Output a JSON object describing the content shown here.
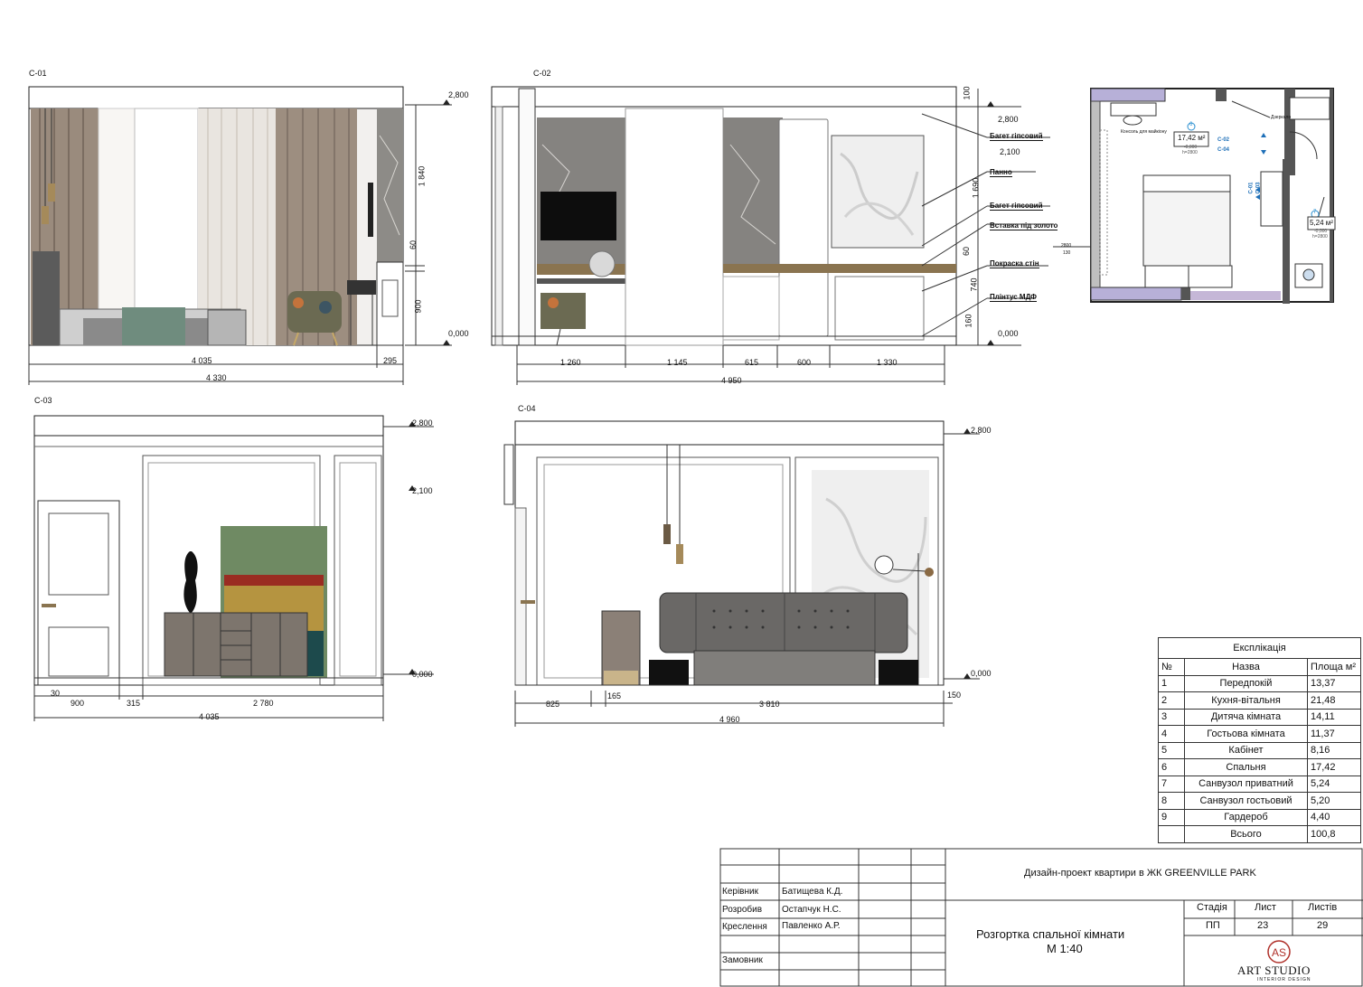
{
  "views": {
    "c01": {
      "tag": "С-01",
      "levels": [
        "2,800",
        "0,000"
      ],
      "vdims": [
        "1 840",
        "60",
        "900"
      ],
      "hdims": [
        "4 035",
        "295",
        "4 330"
      ]
    },
    "c02": {
      "tag": "С-02",
      "levels": [
        "2,800",
        "2,100",
        "0,000"
      ],
      "vdims": [
        "100",
        "1 690",
        "60",
        "740",
        "160"
      ],
      "hdims": [
        "1 260",
        "1 145",
        "615",
        "600",
        "1 330",
        "4 950"
      ],
      "notes": [
        "Багет гіпсовий",
        "Панно",
        "Багет гіпсовий",
        "Вставка під золото",
        "Покраска стін",
        "Плінтус МДФ"
      ]
    },
    "c03": {
      "tag": "С-03",
      "levels": [
        "2,800",
        "2,100",
        "0,000"
      ],
      "hdims": [
        "30",
        "900",
        "315",
        "2 780",
        "4 035"
      ]
    },
    "c04": {
      "tag": "С-04",
      "levels": [
        "2,800",
        "0,000"
      ],
      "hdims": [
        "825",
        "165",
        "3 810",
        "150",
        "4 960"
      ]
    }
  },
  "plan": {
    "room_area": "17,42 м²",
    "room_sub1": "-0,000",
    "room_sub2": "h=2800",
    "bath_area": "5,24 м²",
    "bath_sub1": "-0,000",
    "bath_sub2": "h=2800",
    "room_num": "6",
    "bath_num": "7",
    "label_cons": "Консоль для майкіону",
    "label_mirror": "Дзеркало",
    "level_a": "2800",
    "level_b": "130",
    "tags": [
      "С-02",
      "С-04",
      "С-01",
      "С-03"
    ]
  },
  "explication": {
    "title": "Експлікація",
    "headers": [
      "№",
      "Назва",
      "Площа м²"
    ],
    "rows": [
      [
        "1",
        "Передпокій",
        "13,37"
      ],
      [
        "2",
        "Кухня-вітальня",
        "21,48"
      ],
      [
        "3",
        "Дитяча кімната",
        "14,11"
      ],
      [
        "4",
        "Гостьова кімната",
        "11,37"
      ],
      [
        "5",
        "Кабінет",
        "8,16"
      ],
      [
        "6",
        "Спальня",
        "17,42"
      ],
      [
        "7",
        "Санвузол приватний",
        "5,24"
      ],
      [
        "8",
        "Санвузол гостьовий",
        "5,20"
      ],
      [
        "9",
        "Гардероб",
        "4,40"
      ]
    ],
    "total_label": "Всього",
    "total_value": "100,8"
  },
  "titleblock": {
    "project": "Дизайн-проект квартири в ЖК GREENVILLE PARK",
    "roles": [
      "Керівник",
      "Розробив",
      "Креслення",
      "Замовник"
    ],
    "names": [
      "Батищева К.Д.",
      "Остапчук Н.С.",
      "Павленко А.Р."
    ],
    "sheet_title": "Розгортка спальної кімнати",
    "scale": "М 1:40",
    "col_stage": "Стадія",
    "col_sheet": "Лист",
    "col_sheets": "Листів",
    "stage": "ПП",
    "sheet": "23",
    "sheets": "29",
    "logo_text": "ART STUDIO",
    "logo_sub": "INTERIOR DESIGN",
    "logo_mark": "AS"
  }
}
